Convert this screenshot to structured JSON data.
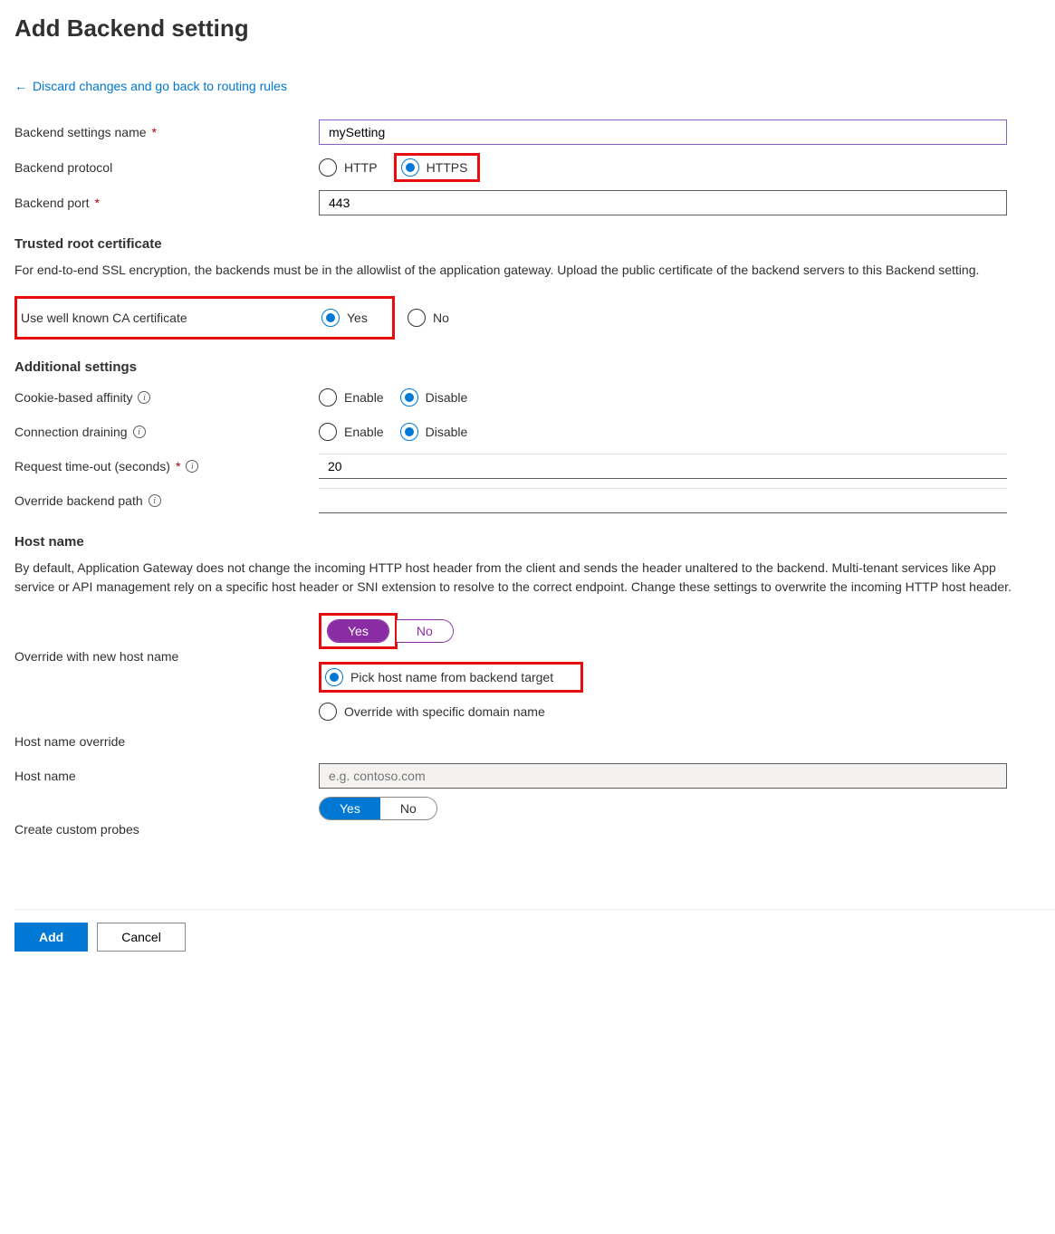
{
  "header": {
    "title": "Add Backend setting"
  },
  "back_link": {
    "label": "Discard changes and go back to routing rules"
  },
  "fields": {
    "settings_name": {
      "label": "Backend settings name",
      "value": "mySetting"
    },
    "protocol": {
      "label": "Backend protocol",
      "http": "HTTP",
      "https": "HTTPS"
    },
    "port": {
      "label": "Backend port",
      "value": "443"
    },
    "trusted_root": {
      "heading": "Trusted root certificate",
      "description": "For end-to-end SSL encryption, the backends must be in the allowlist of the application gateway. Upload the public certificate of the backend servers to this Backend setting."
    },
    "well_known_ca": {
      "label": "Use well known CA certificate",
      "yes": "Yes",
      "no": "No"
    },
    "additional": {
      "heading": "Additional settings"
    },
    "cookie_affinity": {
      "label": "Cookie-based affinity",
      "enable": "Enable",
      "disable": "Disable"
    },
    "conn_drain": {
      "label": "Connection draining",
      "enable": "Enable",
      "disable": "Disable"
    },
    "timeout": {
      "label": "Request time-out (seconds)",
      "value": "20"
    },
    "override_path": {
      "label": "Override backend path",
      "value": ""
    },
    "hostname_section": {
      "heading": "Host name",
      "description": "By default, Application Gateway does not change the incoming HTTP host header from the client and sends the header unaltered to the backend. Multi-tenant services like App service or API management rely on a specific host header or SNI extension to resolve to the correct endpoint. Change these settings to overwrite the incoming HTTP host header."
    },
    "override_hostname": {
      "label": "Override with new host name",
      "yes": "Yes",
      "no": "No",
      "opt_pick": "Pick host name from backend target",
      "opt_specific": "Override with specific domain name"
    },
    "hostname_override": {
      "label": "Host name override"
    },
    "hostname": {
      "label": "Host name",
      "placeholder": "e.g. contoso.com"
    },
    "custom_probes": {
      "label": "Create custom probes",
      "yes": "Yes",
      "no": "No"
    }
  },
  "footer": {
    "add": "Add",
    "cancel": "Cancel"
  }
}
